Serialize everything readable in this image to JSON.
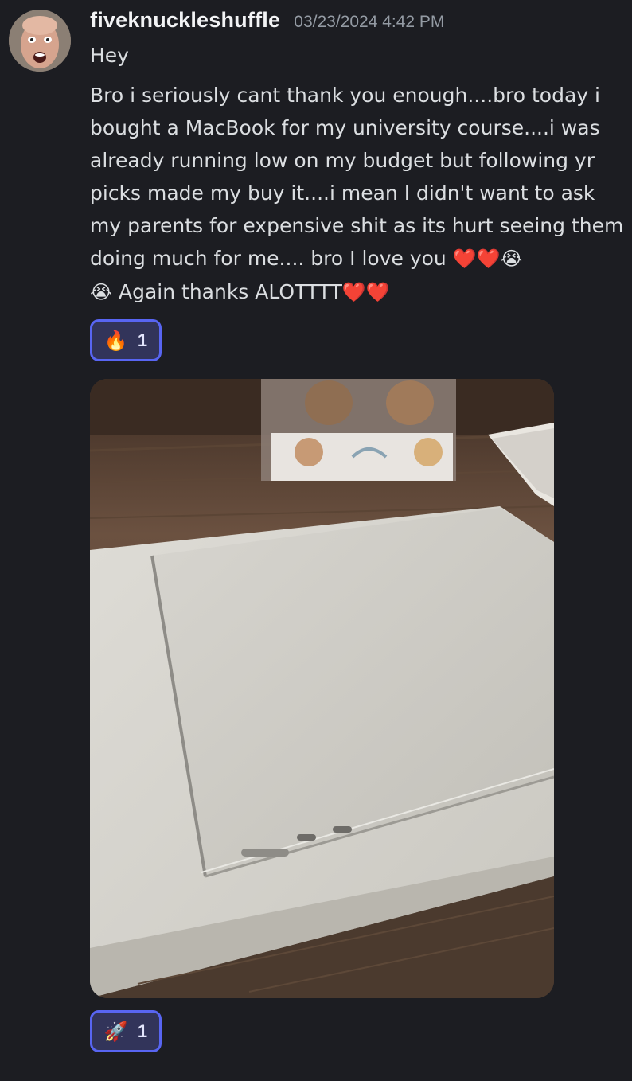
{
  "message": {
    "username": "fiveknuckleshuffle",
    "timestamp": "03/23/2024 4:42 PM",
    "line_hey": "Hey",
    "body_main": "Bro i seriously cant thank you enough....bro today i bought a MacBook for my university course....i was already running low on my budget but following yr picks made my buy it....i mean I didn't want to ask my parents for expensive shit as its hurt seeing them doing much for me.... bro I love you ",
    "body_emoji_1": "❤️❤️😭",
    "body_emoji_2": "😭",
    "body_tail": " Again thanks ALOTTTT",
    "body_emoji_3": "❤️❤️"
  },
  "reactions": [
    {
      "emoji": "🔥",
      "icon": "fire-icon",
      "count": "1"
    },
    {
      "emoji": "🚀",
      "icon": "rocket-icon",
      "count": "1"
    }
  ],
  "attachment": {
    "description_icon": "photo-attachment"
  },
  "colors": {
    "background": "#1c1d22",
    "username": "#f2f3f5",
    "timestamp": "#949ba4",
    "text": "#dbdee1",
    "reaction_border": "#5865f2",
    "reaction_bg": "#32345a"
  }
}
